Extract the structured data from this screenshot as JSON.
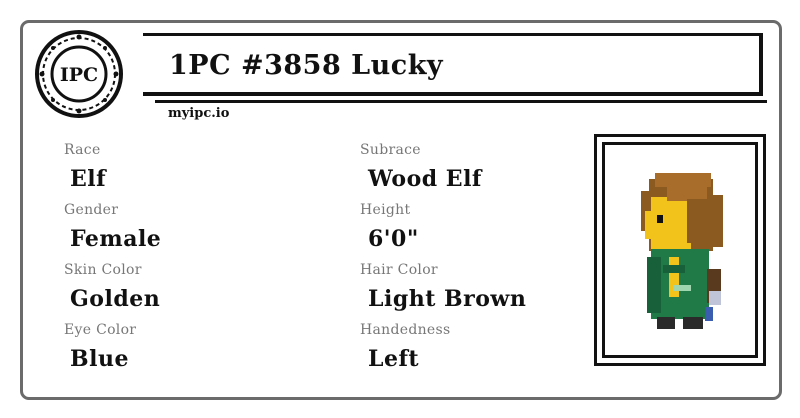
{
  "header": {
    "logo_text": "IPC",
    "title": "1PC #3858 Lucky",
    "site": "myipc.io"
  },
  "fields": {
    "race": {
      "label": "Race",
      "value": "Elf"
    },
    "subrace": {
      "label": "Subrace",
      "value": "Wood Elf"
    },
    "gender": {
      "label": "Gender",
      "value": "Female"
    },
    "height": {
      "label": "Height",
      "value": "6'0\""
    },
    "skin_color": {
      "label": "Skin Color",
      "value": "Golden"
    },
    "hair_color": {
      "label": "Hair Color",
      "value": "Light Brown"
    },
    "eye_color": {
      "label": "Eye Color",
      "value": "Blue"
    },
    "handedness": {
      "label": "Handedness",
      "value": "Left"
    }
  },
  "colors": {
    "card_border": "#6b6b6b",
    "label": "#777777",
    "hair": "#8a5a20",
    "skin": "#f2c31b",
    "cloak": "#1f7a48"
  }
}
